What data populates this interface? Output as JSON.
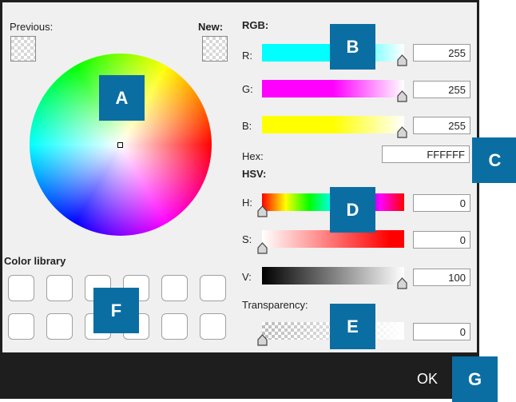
{
  "labels": {
    "previous": "Previous:",
    "new": "New:",
    "rgb": "RGB:",
    "r": "R:",
    "g": "G:",
    "b": "B:",
    "hex": "Hex:",
    "hsv": "HSV:",
    "h": "H:",
    "s": "S:",
    "v": "V:",
    "transparency": "Transparency:",
    "color_library": "Color library"
  },
  "values": {
    "r": "255",
    "g": "255",
    "b": "255",
    "hex": "FFFFFF",
    "h": "0",
    "s": "0",
    "v": "100",
    "transparency": "0"
  },
  "ok_label": "OK",
  "badges": {
    "a": "A",
    "b": "B",
    "c": "C",
    "d": "D",
    "e": "E",
    "f": "F",
    "g": "G"
  },
  "colors": {
    "badge": "#0a6ea3",
    "footer": "#1e1e1e",
    "panel": "#f0f0f0"
  },
  "icons": {
    "thumb": "slider-thumb-icon"
  }
}
